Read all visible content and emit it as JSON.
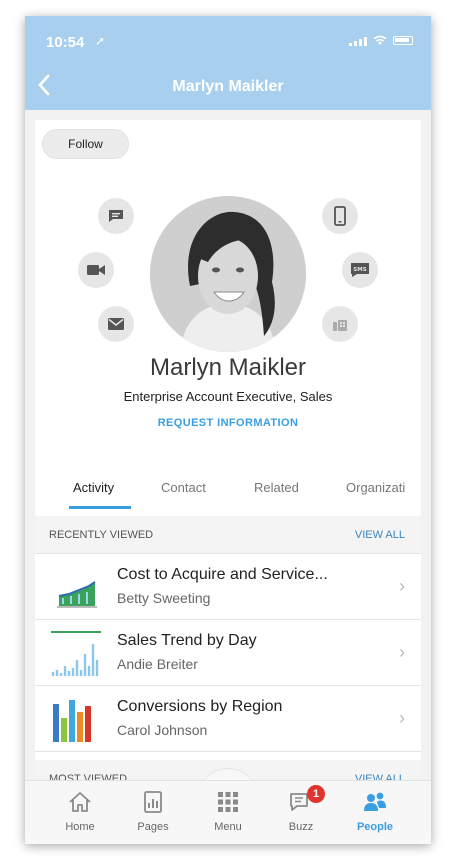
{
  "status_bar": {
    "time": "10:54",
    "location_symbol": "➚"
  },
  "header": {
    "back_icon": "chevron-left-icon",
    "title": "Marlyn Maikler"
  },
  "profile": {
    "follow_label": "Follow",
    "name": "Marlyn Maikler",
    "job_title": "Enterprise Account Executive, Sales",
    "request_label": "REQUEST INFORMATION",
    "actions_left": [
      "chat-icon",
      "video-icon",
      "email-icon"
    ],
    "actions_right": [
      "mobile-phone-icon",
      "sms-icon",
      "desk-phone-icon"
    ],
    "sms_text": "SMS"
  },
  "tabs": [
    {
      "label": "Activity",
      "active": true
    },
    {
      "label": "Contact",
      "active": false
    },
    {
      "label": "Related",
      "active": false
    },
    {
      "label": "Organizati",
      "active": false
    }
  ],
  "recently_viewed": {
    "title": "RECENTLY VIEWED",
    "view_all": "VIEW ALL",
    "items": [
      {
        "title": "Cost to Acquire and Service...",
        "subtitle": "Betty Sweeting"
      },
      {
        "title": "Sales Trend by Day",
        "subtitle": "Andie Breiter"
      },
      {
        "title": "Conversions by Region",
        "subtitle": "Carol Johnson"
      }
    ]
  },
  "most_viewed": {
    "title": "MOST VIEWED",
    "view_all": "VIEW ALL"
  },
  "bottom_nav": [
    {
      "label": "Home",
      "icon": "home-icon"
    },
    {
      "label": "Pages",
      "icon": "pages-icon"
    },
    {
      "label": "Menu",
      "icon": "menu-grid-icon"
    },
    {
      "label": "Buzz",
      "icon": "buzz-chat-icon",
      "badge": "1"
    },
    {
      "label": "People",
      "icon": "people-icon",
      "active": true
    }
  ],
  "colors": {
    "header": "#a8cfee",
    "accent": "#3b9ee0",
    "badge": "#e0342f"
  }
}
